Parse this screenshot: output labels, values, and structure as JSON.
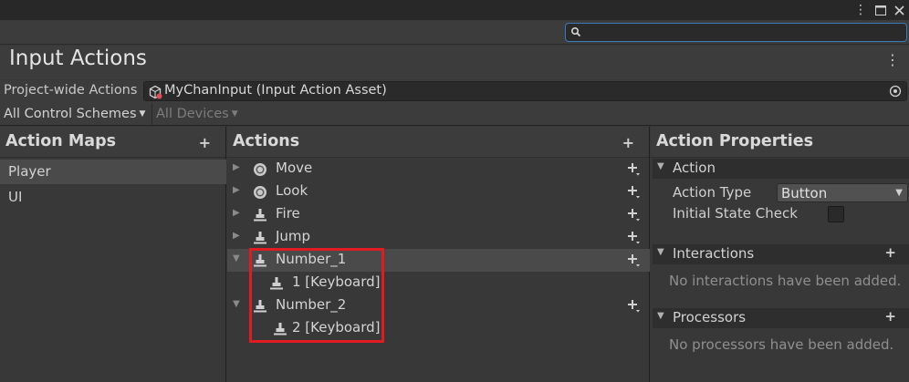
{
  "window": {
    "menu_icon": "kebab-icon",
    "maximize_icon": "maximize-icon",
    "close_icon": "close-icon"
  },
  "search": {
    "placeholder": "",
    "value": ""
  },
  "header": {
    "title": "Input Actions"
  },
  "project_wide": {
    "label": "Project-wide Actions",
    "asset": "MyChanInput (Input Action Asset)"
  },
  "control_schemes": {
    "scheme": "All Control Schemes",
    "devices": "All Devices"
  },
  "action_maps": {
    "title": "Action Maps",
    "add_label": "+",
    "items": [
      {
        "label": "Player"
      },
      {
        "label": "UI"
      }
    ]
  },
  "actions": {
    "title": "Actions",
    "add_label": "+",
    "rows": [
      {
        "label": "Move",
        "icon": "stick-icon"
      },
      {
        "label": "Look",
        "icon": "stick-icon"
      },
      {
        "label": "Fire",
        "icon": "button-action-icon"
      },
      {
        "label": "Jump",
        "icon": "button-action-icon"
      },
      {
        "label": "Number_1",
        "icon": "button-action-icon"
      },
      {
        "label": "1 [Keyboard]",
        "icon": "binding-icon"
      },
      {
        "label": "Number_2",
        "icon": "button-action-icon"
      },
      {
        "label": "2 [Keyboard]",
        "icon": "binding-icon"
      }
    ]
  },
  "properties": {
    "title": "Action Properties",
    "action_section": "Action",
    "action_type_label": "Action Type",
    "action_type_value": "Button",
    "initial_state_label": "Initial State Check",
    "interactions_section": "Interactions",
    "interactions_add": "+",
    "interactions_empty": "No interactions have been added.",
    "processors_section": "Processors",
    "processors_add": "+",
    "processors_empty": "No processors have been added."
  },
  "colors": {
    "highlight": "#e21b23",
    "search_border": "#3a79bb",
    "selected_row": "#4a4a4a"
  }
}
